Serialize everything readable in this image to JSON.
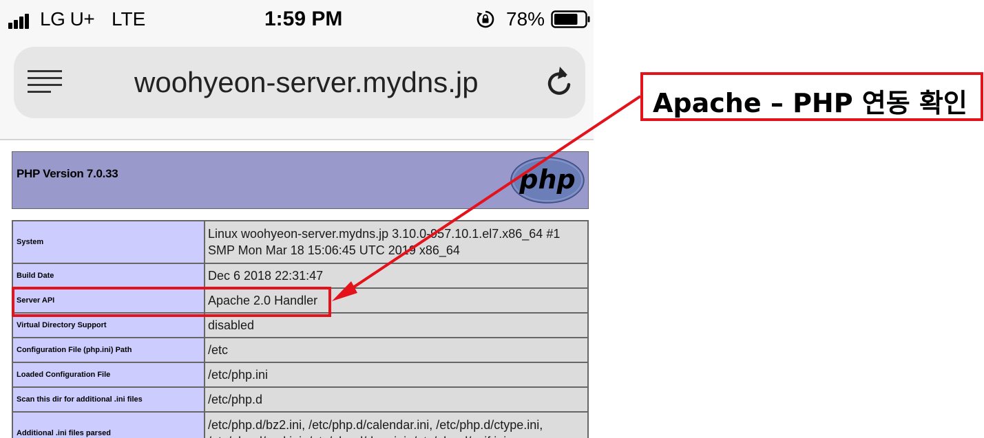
{
  "status_bar": {
    "carrier": "LG U+",
    "network": "LTE",
    "time": "1:59 PM",
    "battery_percent": "78%",
    "battery_level": 0.78,
    "icons": [
      "signal-icon",
      "orientation-lock-icon",
      "battery-icon"
    ]
  },
  "browser": {
    "url": "woohyeon-server.mydns.jp",
    "icons": [
      "menu-icon",
      "reload-icon"
    ]
  },
  "phpinfo": {
    "title": "PHP Version 7.0.33",
    "logo_text": "php",
    "rows": [
      {
        "key": "System",
        "value": "Linux woohyeon-server.mydns.jp 3.10.0-957.10.1.el7.x86_64 #1 SMP Mon Mar 18 15:06:45 UTC 2019 x86_64"
      },
      {
        "key": "Build Date",
        "value": "Dec 6 2018 22:31:47"
      },
      {
        "key": "Server API",
        "value": "Apache 2.0 Handler"
      },
      {
        "key": "Virtual Directory Support",
        "value": "disabled"
      },
      {
        "key": "Configuration File (php.ini) Path",
        "value": "/etc"
      },
      {
        "key": "Loaded Configuration File",
        "value": "/etc/php.ini"
      },
      {
        "key": "Scan this dir for additional .ini files",
        "value": "/etc/php.d"
      },
      {
        "key": "Additional .ini files parsed",
        "value": "/etc/php.d/bz2.ini, /etc/php.d/calendar.ini, /etc/php.d/ctype.ini, /etc/php.d/curl.ini, /etc/php.d/dom.ini, /etc/php.d/exif.ini"
      }
    ]
  },
  "annotation": {
    "callout_text": "Apache – PHP 연동 확인",
    "color": "#e3121b"
  },
  "colors": {
    "php_header": "#9999cc",
    "key_cell": "#ccccff",
    "value_cell": "#dcdcdc"
  }
}
